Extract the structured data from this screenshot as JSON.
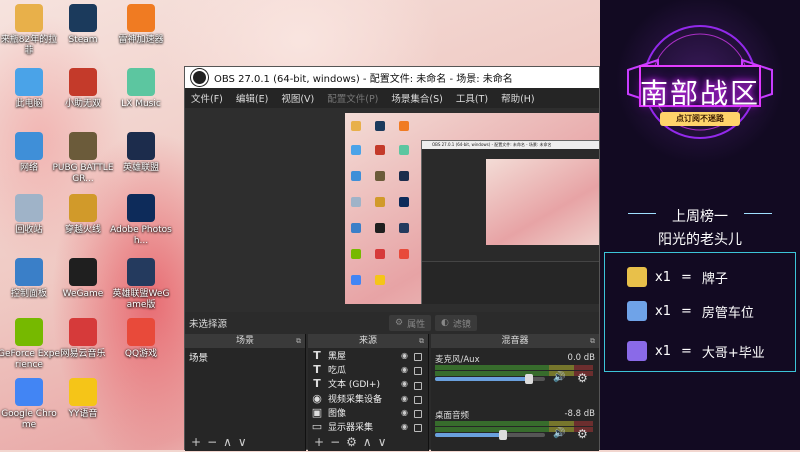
{
  "desktop_icons": [
    {
      "label": "来瓶82年的拉菲",
      "icon": "folder-user-icon",
      "color": "#e8b04a"
    },
    {
      "label": "Steam",
      "icon": "steam-icon",
      "color": "#1b3a5c"
    },
    {
      "label": "雷神加速器",
      "icon": "thunder-accelerator-icon",
      "color": "#f07b22"
    },
    {
      "label": "此电脑",
      "icon": "computer-icon",
      "color": "#4aa3e8"
    },
    {
      "label": "小助无双",
      "icon": "game-app-icon",
      "color": "#c43a2a"
    },
    {
      "label": "LX Music",
      "icon": "music-icon",
      "color": "#5cc6a0"
    },
    {
      "label": "网络",
      "icon": "network-icon",
      "color": "#3f8fd8"
    },
    {
      "label": "PUBG BATTLEGR...",
      "icon": "pubg-icon",
      "color": "#6b5b3a"
    },
    {
      "label": "英雄联盟",
      "icon": "lol-icon",
      "color": "#1c2c4c"
    },
    {
      "label": "回收站",
      "icon": "recycle-bin-icon",
      "color": "#9fb3c8"
    },
    {
      "label": "穿越火线",
      "icon": "crossfire-icon",
      "color": "#d19a2a"
    },
    {
      "label": "Adobe Photosh...",
      "icon": "photoshop-icon",
      "color": "#0d2b5a"
    },
    {
      "label": "控制面板",
      "icon": "control-panel-icon",
      "color": "#3a7fc8"
    },
    {
      "label": "WeGame",
      "icon": "wegame-icon",
      "color": "#1f1f1f"
    },
    {
      "label": "英雄联盟WeGame版",
      "icon": "lol-wegame-icon",
      "color": "#243a5e"
    },
    {
      "label": "GeForce Experience",
      "icon": "geforce-icon",
      "color": "#76b900"
    },
    {
      "label": "网易云音乐",
      "icon": "netease-music-icon",
      "color": "#d63a3a"
    },
    {
      "label": "QQ游戏",
      "icon": "qq-game-icon",
      "color": "#e84a3a"
    },
    {
      "label": "Google Chrome",
      "icon": "chrome-icon",
      "color": "#4285f4"
    },
    {
      "label": "YY语音",
      "icon": "yy-voice-icon",
      "color": "#f5c518"
    }
  ],
  "obs": {
    "title": "OBS 27.0.1 (64-bit, windows) - 配置文件: 未命名 - 场景: 未命名",
    "menu": [
      "文件(F)",
      "编辑(E)",
      "视图(V)",
      "配置文件(P)",
      "场景集合(S)",
      "工具(T)",
      "帮助(H)"
    ],
    "menu_disabled": [
      "配置文件(P)"
    ],
    "no_source_selected": "未选择源",
    "properties_button": "属性",
    "filters_button": "滤镜",
    "docks": {
      "scenes_title": "场景",
      "sources_title": "来源",
      "mixer_title": "混音器"
    },
    "scenes": [
      "场景"
    ],
    "sources": [
      {
        "name": "黑屋",
        "icon": "text-icon"
      },
      {
        "name": "吃瓜",
        "icon": "text-icon"
      },
      {
        "name": "文本 (GDI+)",
        "icon": "text-icon"
      },
      {
        "name": "视频采集设备",
        "icon": "camera-icon"
      },
      {
        "name": "图像",
        "icon": "image-icon"
      },
      {
        "name": "显示器采集",
        "icon": "monitor-icon"
      }
    ],
    "mixer": [
      {
        "name": "麦克风/Aux",
        "db": "0.0 dB",
        "volume": 0.85
      },
      {
        "name": "桌面音频",
        "db": "-8.8 dB",
        "volume": 0.62
      }
    ],
    "footer_glyphs": {
      "add": "+",
      "remove": "−",
      "up": "∧",
      "down": "∨",
      "settings": "⚙"
    }
  },
  "overlay": {
    "title": "南部战区",
    "subtitle": "点订阅不迷路",
    "rank_heading": "上周榜一",
    "rank_name": "阳光的老头儿",
    "gifts": [
      {
        "count": "x1",
        "eq": "=",
        "reward": "牌子",
        "icon": "badge-icon",
        "color": "#e8c04a"
      },
      {
        "count": "x1",
        "eq": "=",
        "reward": "房管车位",
        "icon": "plane-icon",
        "color": "#6fa3e8"
      },
      {
        "count": "x1",
        "eq": "=",
        "reward": "大哥+毕业",
        "icon": "rocket-icon",
        "color": "#8a6ae8"
      }
    ],
    "colors": {
      "neon": "#e23cff",
      "frame": "#3cc4d8",
      "bg": "#0d0a1c"
    }
  }
}
